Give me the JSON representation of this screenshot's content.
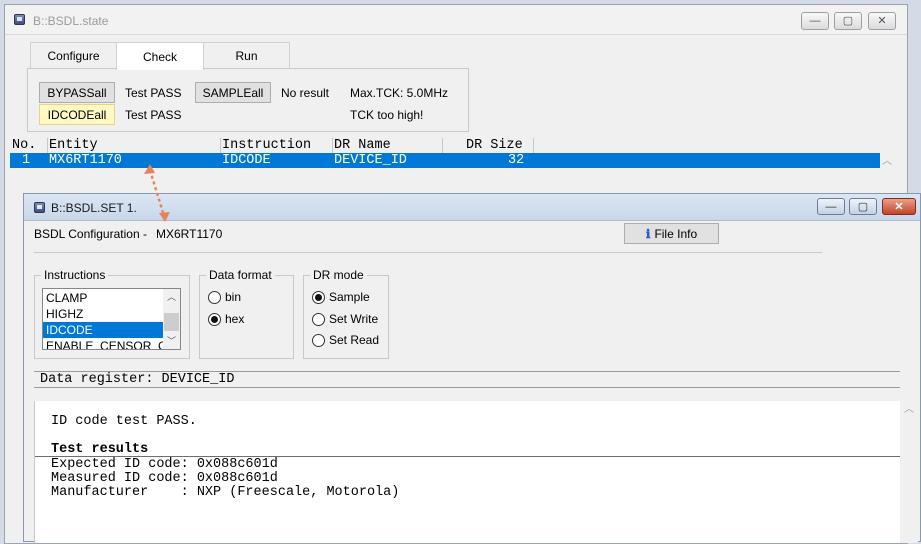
{
  "main_window": {
    "title": "B::BSDL.state",
    "tabs": [
      {
        "label": "Configure"
      },
      {
        "label": "Check"
      },
      {
        "label": "Run"
      }
    ],
    "check": {
      "bypass_button": "BYPASSall",
      "bypass_result": "Test PASS",
      "sample_button": "SAMPLEall",
      "sample_result": "No result",
      "max_tck": "Max.TCK: 5.0MHz",
      "idcode_button": "IDCODEall",
      "idcode_result": "Test PASS",
      "tck_warning": "TCK too high!"
    },
    "table": {
      "headers": {
        "no": "No.",
        "entity": "Entity",
        "instruction": "Instruction",
        "dr_name": "DR Name",
        "dr_size": "DR Size"
      },
      "row": {
        "no": "1",
        "entity": "MX6RT1170",
        "instruction": "IDCODE",
        "dr_name": "DEVICE_ID",
        "dr_size": "32"
      }
    }
  },
  "set_window": {
    "title": "B::BSDL.SET 1.",
    "config_label": "BSDL Configuration -",
    "config_entity": "MX6RT1170",
    "file_info_button": "File Info",
    "instructions": {
      "title": "Instructions",
      "items": [
        "CLAMP",
        "HIGHZ",
        "IDCODE",
        "ENABLE_CENSOR_CTRL"
      ],
      "selected": "IDCODE"
    },
    "data_format": {
      "title": "Data format",
      "options": [
        {
          "label": "bin",
          "checked": false
        },
        {
          "label": "hex",
          "checked": true
        }
      ]
    },
    "dr_mode": {
      "title": "DR mode",
      "options": [
        {
          "label": "Sample",
          "checked": true
        },
        {
          "label": "Set Write",
          "checked": false
        },
        {
          "label": "Set Read",
          "checked": false
        }
      ]
    },
    "data_register_header": "Data register: DEVICE_ID",
    "output": {
      "status": "ID code test PASS.",
      "results_title": "Test results",
      "lines": [
        "Expected ID code: 0x088c601d",
        "Measured ID code: 0x088c601d",
        "Manufacturer    : NXP (Freescale, Motorola)"
      ]
    }
  },
  "colors": {
    "selection": "#0078d7",
    "highlight_button": "#fff8c4",
    "arrow": "#e8825a"
  }
}
